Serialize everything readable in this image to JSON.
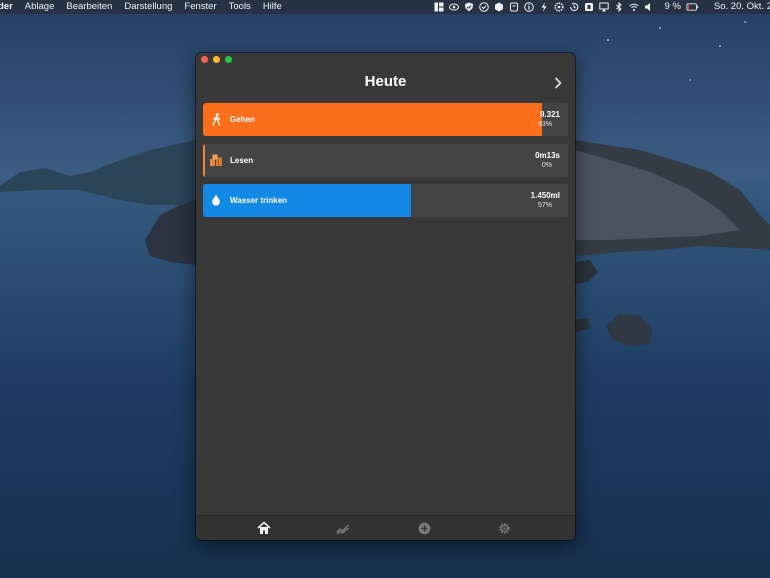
{
  "menubar": {
    "items": [
      "der",
      "Ablage",
      "Bearbeiten",
      "Darstellung",
      "Fenster",
      "Tools",
      "Hilfe"
    ],
    "battery_percent": "9 %",
    "clock": "So. 20. Okt. 2"
  },
  "window": {
    "title": "Heute",
    "habits": [
      {
        "name": "Gehen",
        "value": "9.321",
        "percent": "93%",
        "progress": 0.93,
        "color": "#fb6f1c",
        "icon": "walking-icon"
      },
      {
        "name": "Lesen",
        "value": "0m13s",
        "percent": "0%",
        "progress": 0.0,
        "color": "#e98a3c",
        "icon": "books-icon"
      },
      {
        "name": "Wasser trinken",
        "value": "1.450ml",
        "percent": "57%",
        "progress": 0.57,
        "color": "#1289e5",
        "icon": "water-drop-icon"
      }
    ],
    "tabs": [
      "home-icon",
      "trend-icon",
      "add-icon",
      "settings-icon"
    ]
  }
}
